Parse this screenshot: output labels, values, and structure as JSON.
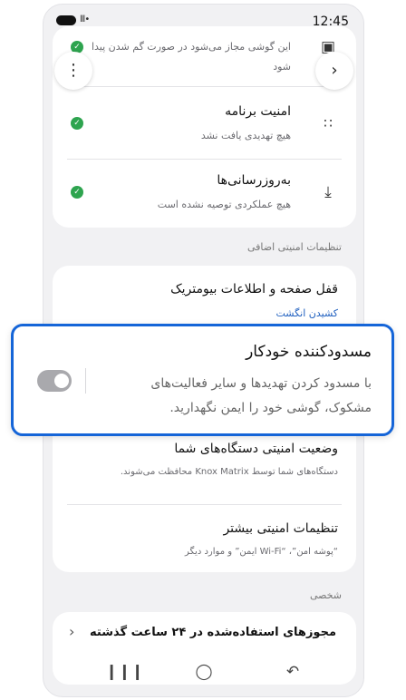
{
  "status_bar": {
    "time": "12:45",
    "signal": "lll•"
  },
  "top_card": {
    "lost_phone_sub_line1": "این گوشی مجاز می‌شود در صورت گم شدن پیدا",
    "lost_phone_sub_line2": "شود",
    "app_security_title": "امنیت برنامه",
    "app_security_sub": "هیچ تهدیدی یافت نشد",
    "updates_title": "به‌روزرسانی‌ها",
    "updates_sub": "هیچ عملکردی توصیه نشده است"
  },
  "section_additional": "تنظیمات امنیتی اضافی",
  "additional_card": {
    "biometric_title": "قفل صفحه و اطلاعات بیومتریک",
    "biometric_link": "کشیدن انگشت",
    "devices_title": "وضعیت امنیتی دستگاه‌های شما",
    "devices_sub": "دستگاه‌های شما توسط Knox Matrix محافظت می‌شوند.",
    "more_title": "تنظیمات امنیتی بیشتر",
    "more_sub": "“پوشه امن”، “Wi-Fi ایمن” و موارد دیگر"
  },
  "auto_blocker": {
    "title": "مسدودکننده خودکار",
    "desc_line1": "با مسدود کردن تهدیدها و سایر فعالیت‌های",
    "desc_line2": "مشکوک، گوشی خود را ایمن نگهدارید.",
    "toggle_on": false
  },
  "section_personal": "شخصی",
  "personal_card": {
    "permissions_title": "مجوزهای استفاده‌شده در ۲۴ ساعت گذشته"
  },
  "colors": {
    "accent": "#1565d8",
    "check": "#2ea44f",
    "link": "#1f5fbf"
  },
  "icons": [
    "more-vertical-icon",
    "chevron-right-icon",
    "apps-grid-icon",
    "download-box-icon",
    "chevron-left-icon",
    "recents-icon",
    "home-icon",
    "back-icon",
    "find-phone-icon"
  ]
}
